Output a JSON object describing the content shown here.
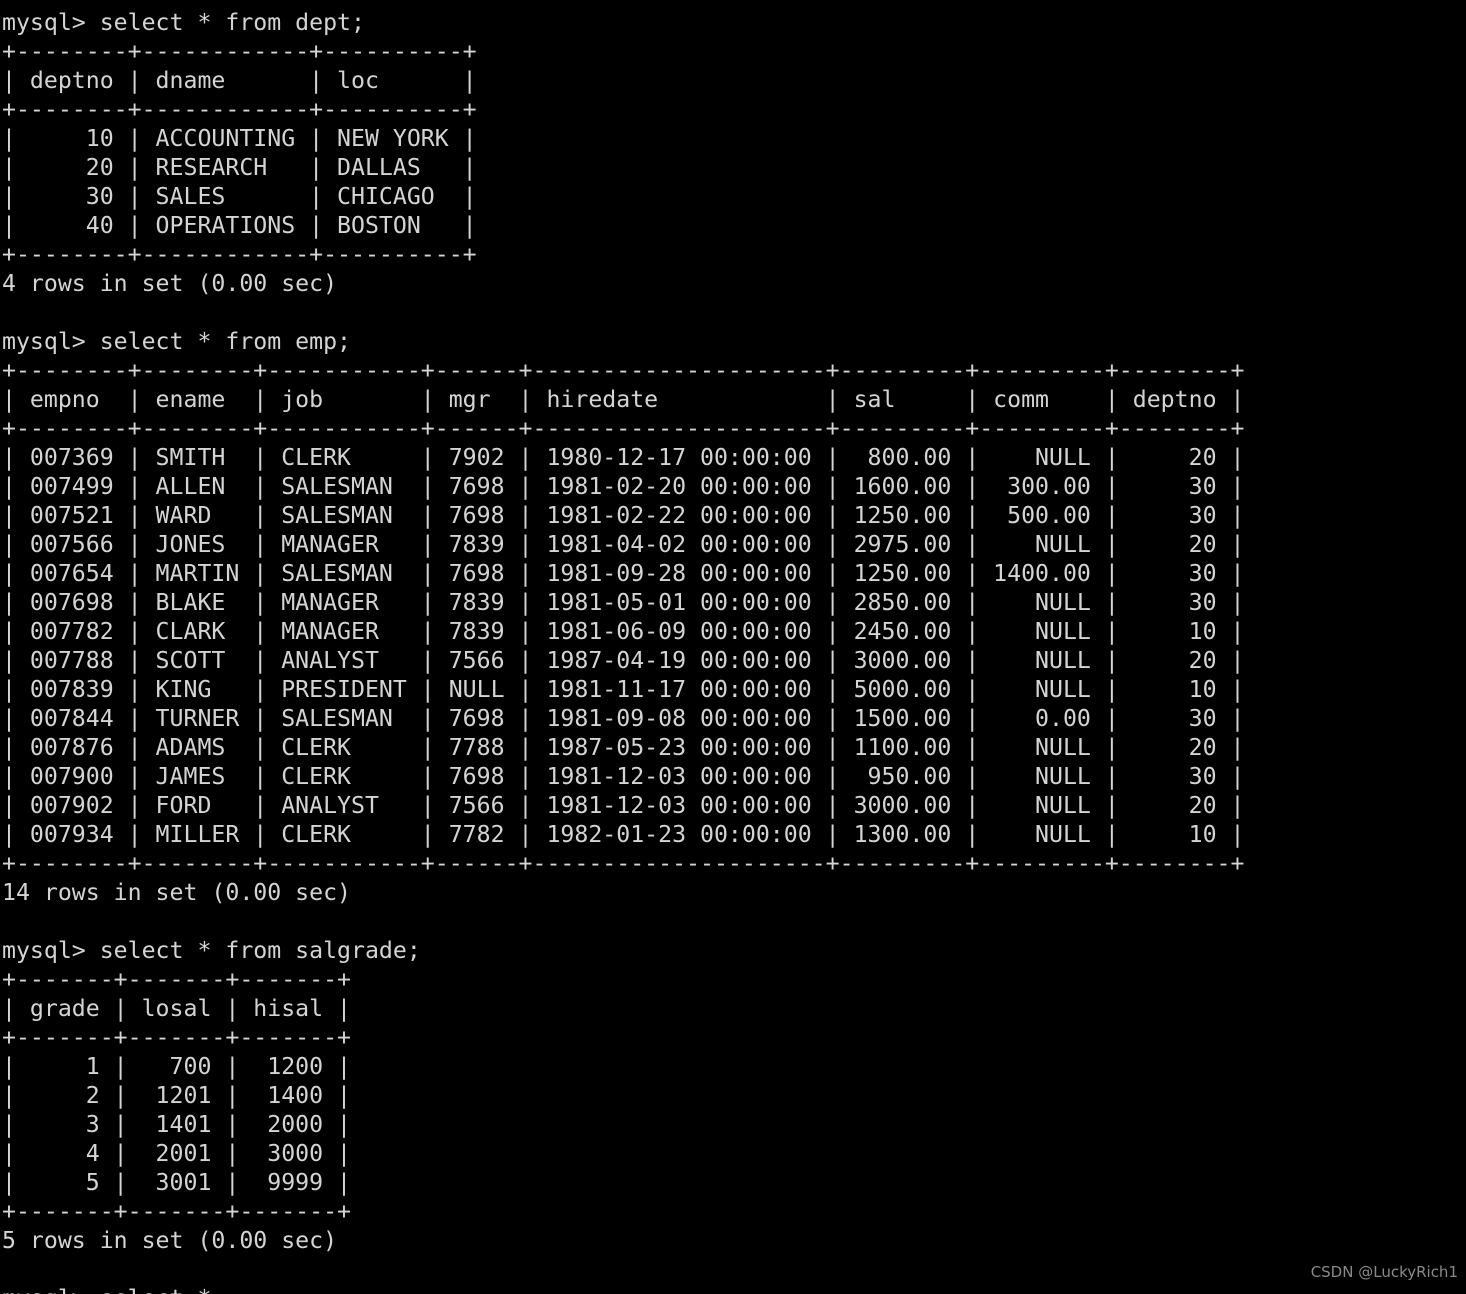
{
  "terminal": {
    "prompt": "mysql> ",
    "foreground_color": "#d4d4d4",
    "background_color": "#000000",
    "watermark": "CSDN @LuckyRich1",
    "blocks": [
      {
        "name": "dept-query",
        "command": "mysql> select * from dept;",
        "border_top": "+--------+------------+----------+",
        "header": "| deptno | dname      | loc      |",
        "border_mid": "+--------+------------+----------+",
        "rows": [
          "|     10 | ACCOUNTING | NEW YORK |",
          "|     20 | RESEARCH   | DALLAS   |",
          "|     30 | SALES      | CHICAGO  |",
          "|     40 | OPERATIONS | BOSTON   |"
        ],
        "border_bottom": "+--------+------------+----------+",
        "status": "4 rows in set (0.00 sec)",
        "table": {
          "name": "dept",
          "columns": [
            "deptno",
            "dname",
            "loc"
          ],
          "data": [
            [
              "10",
              "ACCOUNTING",
              "NEW YORK"
            ],
            [
              "20",
              "RESEARCH",
              "DALLAS"
            ],
            [
              "30",
              "SALES",
              "CHICAGO"
            ],
            [
              "40",
              "OPERATIONS",
              "BOSTON"
            ]
          ],
          "row_count": 4,
          "elapsed": "0.00 sec"
        }
      },
      {
        "name": "emp-query",
        "command": "mysql> select * from emp;",
        "border_top": "+--------+--------+-----------+------+---------------------+---------+---------+--------+",
        "header": "| empno  | ename  | job       | mgr  | hiredate            | sal     | comm    | deptno |",
        "border_mid": "+--------+--------+-----------+------+---------------------+---------+---------+--------+",
        "rows": [
          "| 007369 | SMITH  | CLERK     | 7902 | 1980-12-17 00:00:00 |  800.00 |    NULL |     20 |",
          "| 007499 | ALLEN  | SALESMAN  | 7698 | 1981-02-20 00:00:00 | 1600.00 |  300.00 |     30 |",
          "| 007521 | WARD   | SALESMAN  | 7698 | 1981-02-22 00:00:00 | 1250.00 |  500.00 |     30 |",
          "| 007566 | JONES  | MANAGER   | 7839 | 1981-04-02 00:00:00 | 2975.00 |    NULL |     20 |",
          "| 007654 | MARTIN | SALESMAN  | 7698 | 1981-09-28 00:00:00 | 1250.00 | 1400.00 |     30 |",
          "| 007698 | BLAKE  | MANAGER   | 7839 | 1981-05-01 00:00:00 | 2850.00 |    NULL |     30 |",
          "| 007782 | CLARK  | MANAGER   | 7839 | 1981-06-09 00:00:00 | 2450.00 |    NULL |     10 |",
          "| 007788 | SCOTT  | ANALYST   | 7566 | 1987-04-19 00:00:00 | 3000.00 |    NULL |     20 |",
          "| 007839 | KING   | PRESIDENT | NULL | 1981-11-17 00:00:00 | 5000.00 |    NULL |     10 |",
          "| 007844 | TURNER | SALESMAN  | 7698 | 1981-09-08 00:00:00 | 1500.00 |    0.00 |     30 |",
          "| 007876 | ADAMS  | CLERK     | 7788 | 1987-05-23 00:00:00 | 1100.00 |    NULL |     20 |",
          "| 007900 | JAMES  | CLERK     | 7698 | 1981-12-03 00:00:00 |  950.00 |    NULL |     30 |",
          "| 007902 | FORD   | ANALYST   | 7566 | 1981-12-03 00:00:00 | 3000.00 |    NULL |     20 |",
          "| 007934 | MILLER | CLERK     | 7782 | 1982-01-23 00:00:00 | 1300.00 |    NULL |     10 |"
        ],
        "border_bottom": "+--------+--------+-----------+------+---------------------+---------+---------+--------+",
        "status": "14 rows in set (0.00 sec)",
        "table": {
          "name": "emp",
          "columns": [
            "empno",
            "ename",
            "job",
            "mgr",
            "hiredate",
            "sal",
            "comm",
            "deptno"
          ],
          "data": [
            [
              "007369",
              "SMITH",
              "CLERK",
              "7902",
              "1980-12-17 00:00:00",
              "800.00",
              "NULL",
              "20"
            ],
            [
              "007499",
              "ALLEN",
              "SALESMAN",
              "7698",
              "1981-02-20 00:00:00",
              "1600.00",
              "300.00",
              "30"
            ],
            [
              "007521",
              "WARD",
              "SALESMAN",
              "7698",
              "1981-02-22 00:00:00",
              "1250.00",
              "500.00",
              "30"
            ],
            [
              "007566",
              "JONES",
              "MANAGER",
              "7839",
              "1981-04-02 00:00:00",
              "2975.00",
              "NULL",
              "20"
            ],
            [
              "007654",
              "MARTIN",
              "SALESMAN",
              "7698",
              "1981-09-28 00:00:00",
              "1250.00",
              "1400.00",
              "30"
            ],
            [
              "007698",
              "BLAKE",
              "MANAGER",
              "7839",
              "1981-05-01 00:00:00",
              "2850.00",
              "NULL",
              "30"
            ],
            [
              "007782",
              "CLARK",
              "MANAGER",
              "7839",
              "1981-06-09 00:00:00",
              "2450.00",
              "NULL",
              "10"
            ],
            [
              "007788",
              "SCOTT",
              "ANALYST",
              "7566",
              "1987-04-19 00:00:00",
              "3000.00",
              "NULL",
              "20"
            ],
            [
              "007839",
              "KING",
              "PRESIDENT",
              "NULL",
              "1981-11-17 00:00:00",
              "5000.00",
              "NULL",
              "10"
            ],
            [
              "007844",
              "TURNER",
              "SALESMAN",
              "7698",
              "1981-09-08 00:00:00",
              "1500.00",
              "0.00",
              "30"
            ],
            [
              "007876",
              "ADAMS",
              "CLERK",
              "7788",
              "1987-05-23 00:00:00",
              "1100.00",
              "NULL",
              "20"
            ],
            [
              "007900",
              "JAMES",
              "CLERK",
              "7698",
              "1981-12-03 00:00:00",
              "950.00",
              "NULL",
              "30"
            ],
            [
              "007902",
              "FORD",
              "ANALYST",
              "7566",
              "1981-12-03 00:00:00",
              "3000.00",
              "NULL",
              "20"
            ],
            [
              "007934",
              "MILLER",
              "CLERK",
              "7782",
              "1982-01-23 00:00:00",
              "1300.00",
              "NULL",
              "10"
            ]
          ],
          "row_count": 14,
          "elapsed": "0.00 sec"
        }
      },
      {
        "name": "salgrade-query",
        "command": "mysql> select * from salgrade;",
        "border_top": "+-------+-------+-------+",
        "header": "| grade | losal | hisal |",
        "border_mid": "+-------+-------+-------+",
        "rows": [
          "|     1 |   700 |  1200 |",
          "|     2 |  1201 |  1400 |",
          "|     3 |  1401 |  2000 |",
          "|     4 |  2001 |  3000 |",
          "|     5 |  3001 |  9999 |"
        ],
        "border_bottom": "+-------+-------+-------+",
        "status": "5 rows in set (0.00 sec)",
        "table": {
          "name": "salgrade",
          "columns": [
            "grade",
            "losal",
            "hisal"
          ],
          "data": [
            [
              "1",
              "700",
              "1200"
            ],
            [
              "2",
              "1201",
              "1400"
            ],
            [
              "3",
              "1401",
              "2000"
            ],
            [
              "4",
              "2001",
              "3000"
            ],
            [
              "5",
              "3001",
              "9999"
            ]
          ],
          "row_count": 5,
          "elapsed": "0.00 sec"
        }
      }
    ],
    "trailing_clipped_line": "mysql> select * "
  }
}
